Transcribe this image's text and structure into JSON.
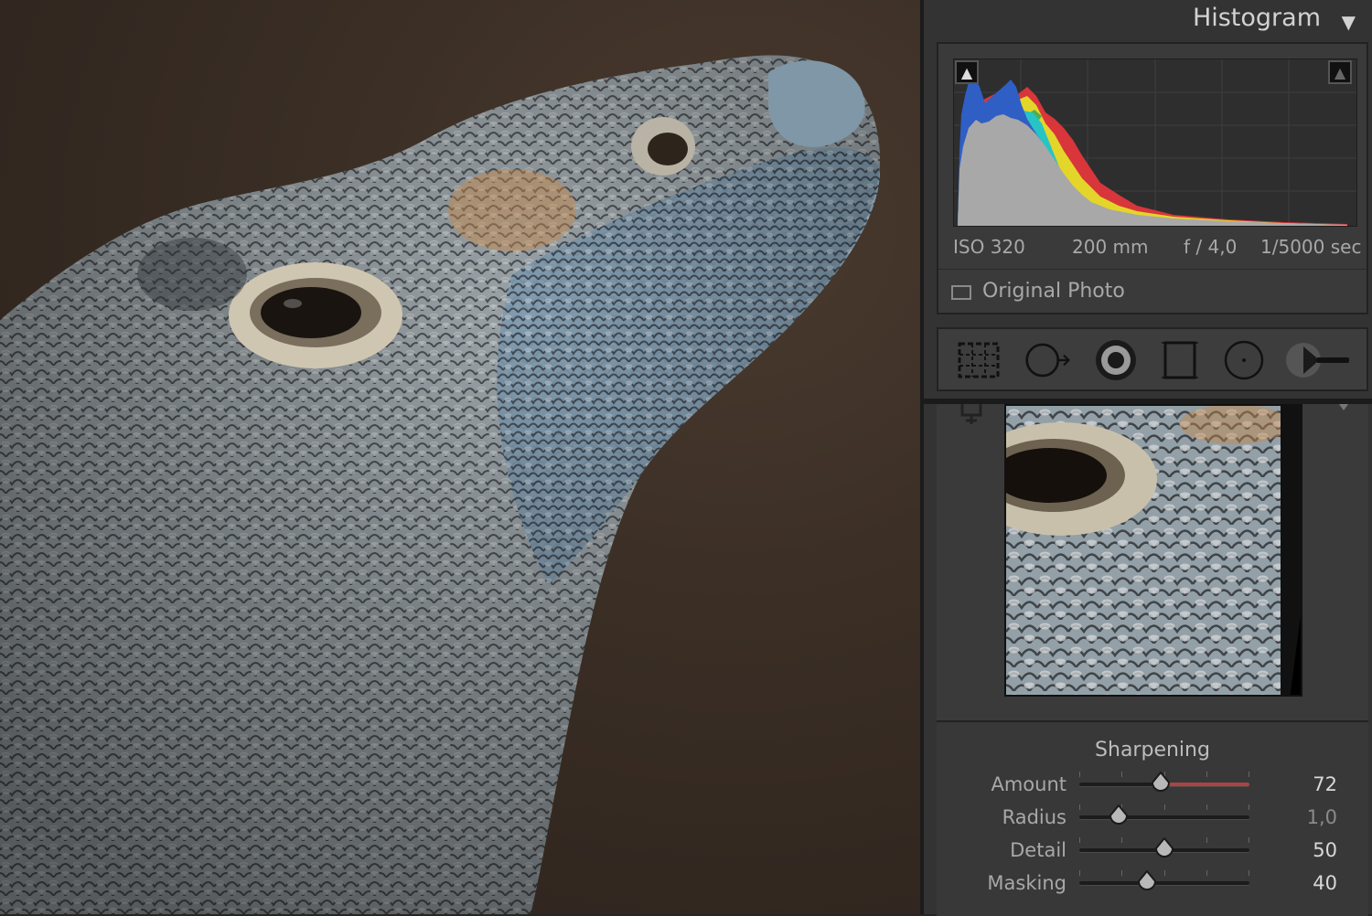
{
  "panel": {
    "title": "Histogram",
    "collapse_icon": "triangle-down-icon"
  },
  "histogram": {
    "exif": {
      "iso": "ISO 320",
      "focal_length": "200 mm",
      "aperture": "f / 4,0",
      "shutter": "1/5000 sec"
    },
    "original_photo_label": "Original Photo",
    "clip_icons": [
      "shadow-clipping-icon",
      "highlight-clipping-icon"
    ],
    "channel_colors": {
      "blue": "#2f5fc4",
      "cyan": "#27c4c4",
      "yellow": "#e4d52a",
      "red": "#d8363a",
      "gray": "#a8a8a8"
    }
  },
  "tools": [
    "crop-overlay-icon",
    "spot-removal-icon",
    "red-eye-icon",
    "graduated-filter-icon",
    "radial-filter-icon",
    "adjustment-brush-icon"
  ],
  "sharpening": {
    "title": "Sharpening",
    "sliders": [
      {
        "label": "Amount",
        "value": "72",
        "fraction": 0.48,
        "dim": false
      },
      {
        "label": "Radius",
        "value": "1,0",
        "fraction": 0.23,
        "dim": true
      },
      {
        "label": "Detail",
        "value": "50",
        "fraction": 0.5,
        "dim": false
      },
      {
        "label": "Masking",
        "value": "40",
        "fraction": 0.4,
        "dim": false
      }
    ]
  }
}
